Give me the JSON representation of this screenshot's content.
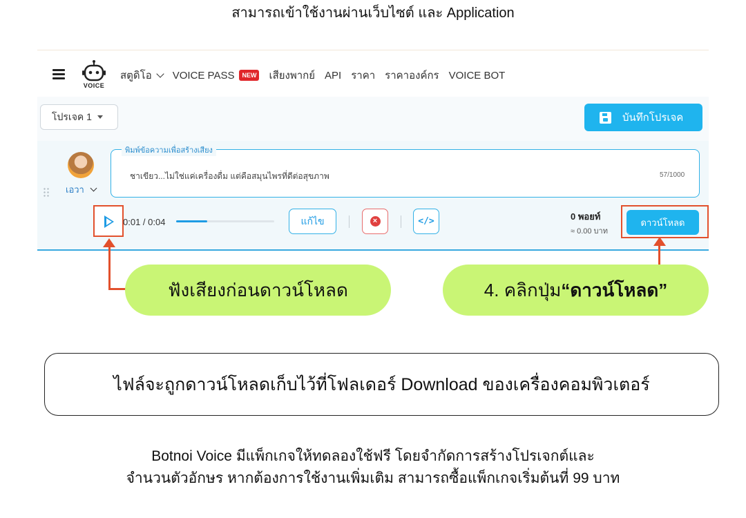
{
  "caption_top": "สามารถเข้าใช้งานผ่านเว็บไซต์ และ Application",
  "app": {
    "logo_text": "VOICE",
    "nav": {
      "studio": "สตูดิโอ",
      "voice_pass": "VOICE PASS",
      "new_badge": "NEW",
      "voiceover": "เสียงพากย์",
      "api": "API",
      "price": "ราคา",
      "enterprise_price": "ราคาองค์กร",
      "voice_bot": "VOICE BOT"
    },
    "project_select": "โปรเจค 1",
    "save_button": "บันทึกโปรเจค",
    "speaker": {
      "name": "เอวา"
    },
    "text_field": {
      "legend": "พิมพ์ข้อความเพื่อสร้างเสียง",
      "value": "ชาเขียว...ไม่ใช่แค่เครื่องดื่ม แต่คือสมุนไพรที่ดีต่อสุขภาพ",
      "counter": "57/1000"
    },
    "player": {
      "time": "0:01 / 0:04",
      "progress_percent": 32
    },
    "edit_button": "แก้ไข",
    "code_symbol": "</>",
    "points": "0 พอยท์",
    "baht": "≈ 0.00 บาท",
    "download_button": "ดาวน์โหลด"
  },
  "callouts": {
    "listen": "ฟังเสียงก่อนดาวน์โหลด",
    "step_prefix": "4. คลิกปุ่ม ",
    "step_bold": "“ดาวน์โหลด”"
  },
  "note": "ไฟล์จะถูกดาวน์โหลดเก็บไว้ที่โฟลเดอร์ Download ของเครื่องคอมพิวเตอร์",
  "footer": {
    "line1": "Botnoi Voice มีแพ็กเกจให้ทดลองใช้ฟรี โดยจำกัดการสร้างโปรเจกต์และ",
    "line2": "จำนวนตัวอักษร หากต้องการใช้งานเพิ่มเติม สามารถซื้อแพ็กเกจเริ่มต้นที่ 99 บาท"
  },
  "colors": {
    "accent": "#1fb4ee",
    "highlight": "#e2502c",
    "pill": "#c9f575"
  }
}
